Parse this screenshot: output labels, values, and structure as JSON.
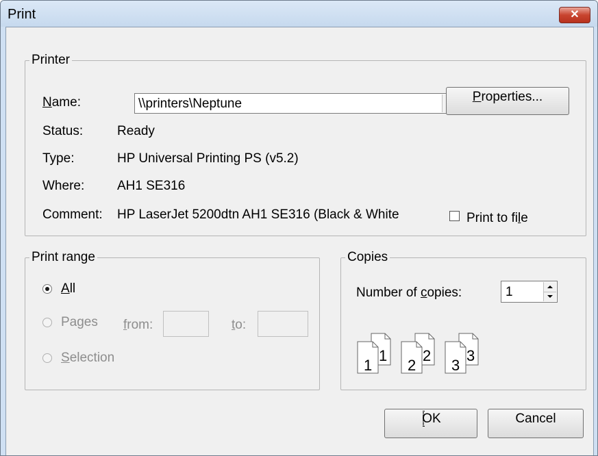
{
  "window": {
    "title": "Print",
    "close_glyph": "✕"
  },
  "printer": {
    "group_label": "Printer",
    "name_label": "Name:",
    "name_value": "\\\\printers\\Neptune",
    "properties_label": "Properties...",
    "status_label": "Status:",
    "status_value": "Ready",
    "type_label": "Type:",
    "type_value": "HP Universal Printing PS (v5.2)",
    "where_label": "Where:",
    "where_value": "AH1 SE316",
    "comment_label": "Comment:",
    "comment_value": "HP LaserJet 5200dtn  AH1 SE316 (Black & White",
    "print_to_file_label": "Print to file",
    "print_to_file_checked": false
  },
  "print_range": {
    "group_label": "Print range",
    "all_label": "All",
    "pages_label": "Pages",
    "from_label": "from:",
    "to_label": "to:",
    "from_value": "",
    "to_value": "",
    "selection_label": "Selection",
    "selected": "All"
  },
  "copies": {
    "group_label": "Copies",
    "number_label": "Number of copies:",
    "number_value": "1",
    "collate_pages": [
      "1",
      "1",
      "2",
      "2",
      "3",
      "3"
    ]
  },
  "buttons": {
    "ok": "OK",
    "cancel": "Cancel"
  }
}
